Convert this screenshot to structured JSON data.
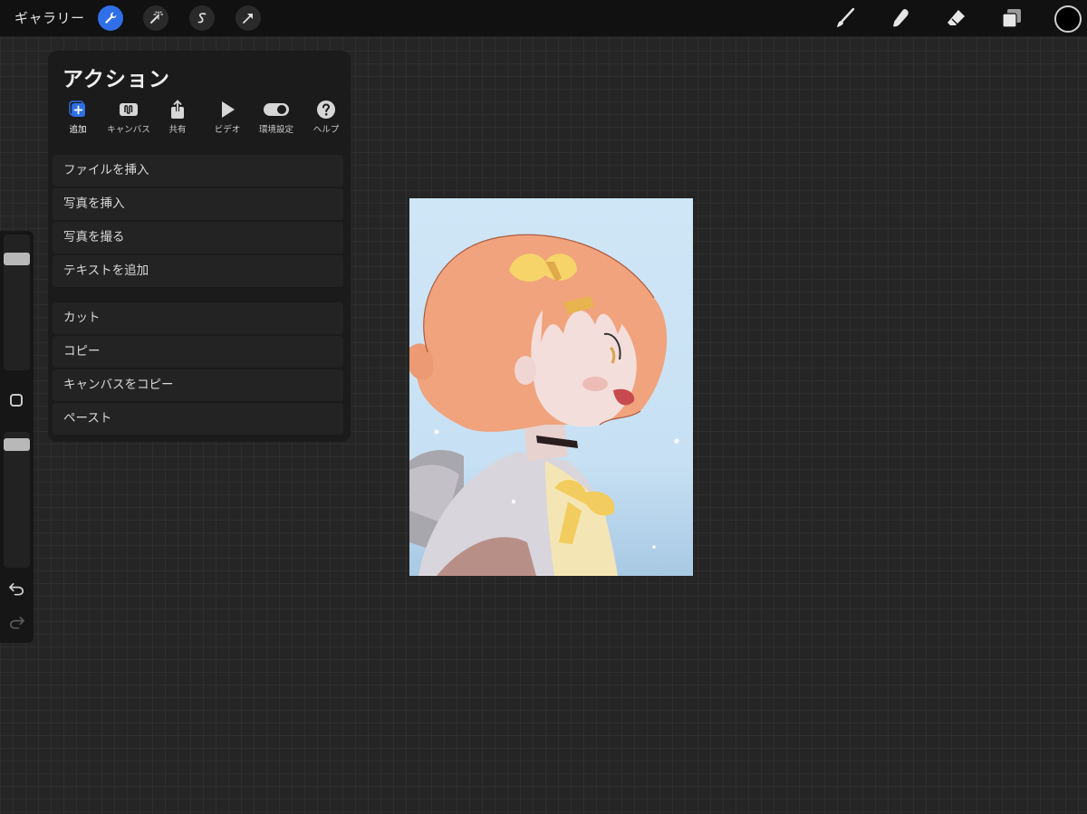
{
  "topbar": {
    "gallery_label": "ギャラリー",
    "tools_left": [
      {
        "name": "actions",
        "icon": "wrench-icon",
        "active": true
      },
      {
        "name": "adjustments",
        "icon": "magic-wand-icon",
        "active": false
      },
      {
        "name": "selection",
        "icon": "selection-s-icon",
        "active": false
      },
      {
        "name": "transform",
        "icon": "arrow-cursor-icon",
        "active": false
      }
    ],
    "tools_right": [
      {
        "name": "brush",
        "icon": "brush-icon"
      },
      {
        "name": "smudge",
        "icon": "smudge-finger-icon"
      },
      {
        "name": "eraser",
        "icon": "eraser-icon"
      },
      {
        "name": "layers",
        "icon": "layers-icon"
      }
    ],
    "current_color": "#000000",
    "accent_color": "#2f6fe8"
  },
  "actions_panel": {
    "title": "アクション",
    "tabs": [
      {
        "label": "追加",
        "icon": "add-icon",
        "active": true
      },
      {
        "label": "キャンバス",
        "icon": "canvas-icon",
        "active": false
      },
      {
        "label": "共有",
        "icon": "share-icon",
        "active": false
      },
      {
        "label": "ビデオ",
        "icon": "play-icon",
        "active": false
      },
      {
        "label": "環境設定",
        "icon": "toggle-icon",
        "active": false
      },
      {
        "label": "ヘルプ",
        "icon": "help-icon",
        "active": false
      }
    ],
    "insert_items": [
      "ファイルを挿入",
      "写真を挿入",
      "写真を撮る",
      "テキストを追加"
    ],
    "edit_items": [
      "カット",
      "コピー",
      "キャンバスをコピー",
      "ペースト"
    ]
  },
  "sidebar": {
    "brush_size_level": 0.25,
    "opacity_level": 0.05,
    "modify_icon": "square-icon",
    "undo_icon": "undo-icon",
    "redo_icon": "redo-icon"
  }
}
